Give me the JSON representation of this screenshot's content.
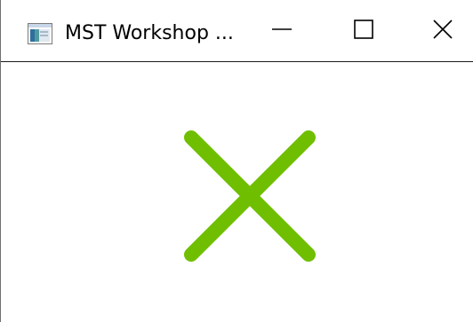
{
  "window": {
    "title": "MST Workshop ..."
  },
  "titlebar_buttons": {
    "minimize_icon": "minimize-icon",
    "maximize_icon": "maximize-icon",
    "close_icon": "close-icon"
  },
  "content": {
    "status_icon": "cross-icon",
    "status_color": "#6fbf00"
  }
}
